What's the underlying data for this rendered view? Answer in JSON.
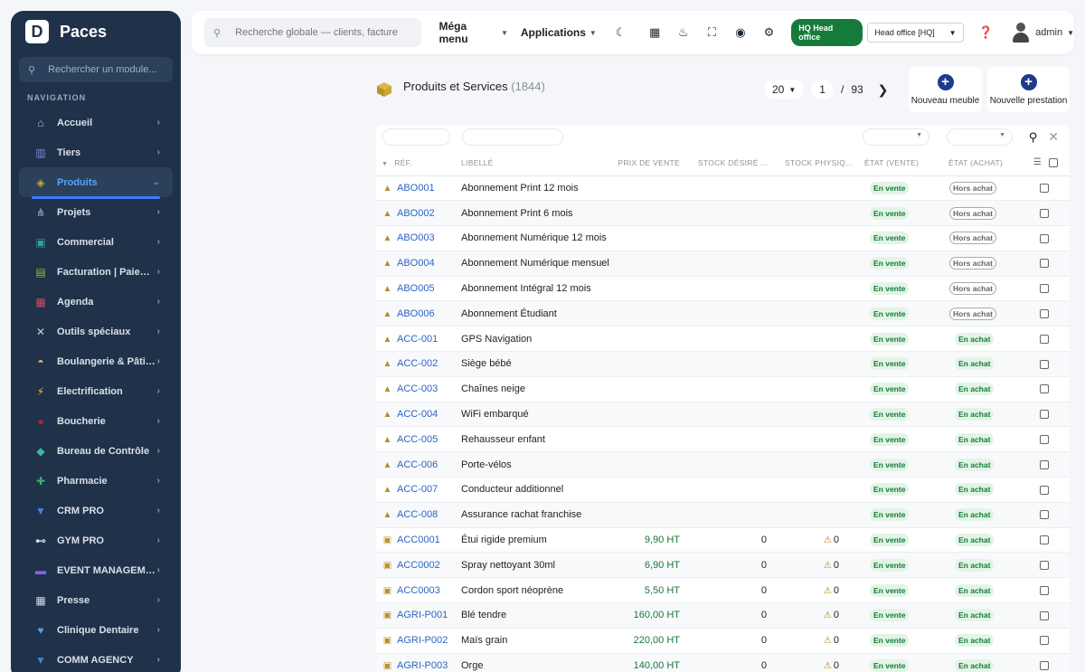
{
  "brand": {
    "logo_letter": "D",
    "name": "Paces"
  },
  "sidebar": {
    "search_placeholder": "Rechercher un module...",
    "section_title": "NAVIGATION",
    "items": [
      {
        "label": "Accueil",
        "icon": "home-icon",
        "glyph": "⌂",
        "color": "#b8c2cf",
        "active": false
      },
      {
        "label": "Tiers",
        "icon": "building-icon",
        "glyph": "▥",
        "color": "#7d86d9",
        "active": false
      },
      {
        "label": "Produits",
        "icon": "box-icon",
        "glyph": "◈",
        "color": "#c9a73a",
        "active": true
      },
      {
        "label": "Projets",
        "icon": "project-icon",
        "glyph": "⋔",
        "color": "#8e9ab0",
        "active": false
      },
      {
        "label": "Commercial",
        "icon": "briefcase-icon",
        "glyph": "▣",
        "color": "#2fa39b",
        "active": false
      },
      {
        "label": "Facturation | Paiement",
        "icon": "invoice-icon",
        "glyph": "▤",
        "color": "#7fbf3f",
        "active": false
      },
      {
        "label": "Agenda",
        "icon": "calendar-icon",
        "glyph": "▦",
        "color": "#c24f6b",
        "active": false
      },
      {
        "label": "Outils spéciaux",
        "icon": "tools-icon",
        "glyph": "✕",
        "color": "#c8cfd9",
        "active": false
      },
      {
        "label": "Boulangerie & Pâtiss...",
        "icon": "bread-icon",
        "glyph": "◓",
        "color": "#e6b86a",
        "active": false
      },
      {
        "label": "Electrification",
        "icon": "bolt-icon",
        "glyph": "⚡",
        "color": "#f2c21a",
        "active": false
      },
      {
        "label": "Boucherie",
        "icon": "meat-icon",
        "glyph": "●",
        "color": "#b0262d",
        "active": false
      },
      {
        "label": "Bureau de Contrôle",
        "icon": "shield-icon",
        "glyph": "◆",
        "color": "#3fb7a5",
        "active": false
      },
      {
        "label": "Pharmacie",
        "icon": "cross-icon",
        "glyph": "✚",
        "color": "#2fb36b",
        "active": false
      },
      {
        "label": "CRM PRO",
        "icon": "funnel-icon",
        "glyph": "▼",
        "color": "#4a7be0",
        "active": false
      },
      {
        "label": "GYM PRO",
        "icon": "dumbbell-icon",
        "glyph": "⊷",
        "color": "#d9dee6",
        "active": false
      },
      {
        "label": "EVENT MANAGEME...",
        "icon": "ticket-icon",
        "glyph": "▬",
        "color": "#8b5cf6",
        "active": false
      },
      {
        "label": "Presse",
        "icon": "newspaper-icon",
        "glyph": "▦",
        "color": "#d7d9e0",
        "active": false
      },
      {
        "label": "Clinique Dentaire",
        "icon": "tooth-icon",
        "glyph": "♥",
        "color": "#4aa3e0",
        "active": false
      },
      {
        "label": "COMM AGENCY",
        "icon": "funnel-icon",
        "glyph": "▼",
        "color": "#4a7be0",
        "active": false
      }
    ]
  },
  "topbar": {
    "search_placeholder": "Recherche globale — clients, factures, p",
    "mega_menu": "Méga menu",
    "applications": "Applications",
    "hq_badge": "HQ Head office",
    "office_select": "Head office [HQ]",
    "user": "admin"
  },
  "page": {
    "title": "Produits et Services",
    "count": "(1844)",
    "per_page": "20",
    "current_page": "1",
    "sep": "/",
    "total_pages": "93",
    "btn_new_furniture": "Nouveau meuble",
    "btn_new_service": "Nouvelle prestation"
  },
  "table": {
    "headers": {
      "ref": "RÉF.",
      "label": "LIBELLÉ",
      "price": "PRIX DE VENTE",
      "stock_desired": "STOCK DÉSIRÉ ...",
      "stock_physical": "STOCK PHYSIQUE",
      "state_sale": "ÉTAT (VENTE)",
      "state_purchase": "ÉTAT (ACHAT)"
    },
    "rows": [
      {
        "type": "service",
        "ref": "ABO001",
        "label": "Abonnement Print 12 mois",
        "price": "",
        "desired": "",
        "physical": "",
        "sale": "En vente",
        "purchase": "Hors achat"
      },
      {
        "type": "service",
        "ref": "ABO002",
        "label": "Abonnement Print 6 mois",
        "price": "",
        "desired": "",
        "physical": "",
        "sale": "En vente",
        "purchase": "Hors achat"
      },
      {
        "type": "service",
        "ref": "ABO003",
        "label": "Abonnement Numérique 12 mois",
        "price": "",
        "desired": "",
        "physical": "",
        "sale": "En vente",
        "purchase": "Hors achat"
      },
      {
        "type": "service",
        "ref": "ABO004",
        "label": "Abonnement Numérique mensuel",
        "price": "",
        "desired": "",
        "physical": "",
        "sale": "En vente",
        "purchase": "Hors achat"
      },
      {
        "type": "service",
        "ref": "ABO005",
        "label": "Abonnement Intégral 12 mois",
        "price": "",
        "desired": "",
        "physical": "",
        "sale": "En vente",
        "purchase": "Hors achat"
      },
      {
        "type": "service",
        "ref": "ABO006",
        "label": "Abonnement Étudiant",
        "price": "",
        "desired": "",
        "physical": "",
        "sale": "En vente",
        "purchase": "Hors achat"
      },
      {
        "type": "service",
        "ref": "ACC-001",
        "label": "GPS Navigation",
        "price": "",
        "desired": "",
        "physical": "",
        "sale": "En vente",
        "purchase": "En achat"
      },
      {
        "type": "service",
        "ref": "ACC-002",
        "label": "Siège bébé",
        "price": "",
        "desired": "",
        "physical": "",
        "sale": "En vente",
        "purchase": "En achat"
      },
      {
        "type": "service",
        "ref": "ACC-003",
        "label": "Chaînes neige",
        "price": "",
        "desired": "",
        "physical": "",
        "sale": "En vente",
        "purchase": "En achat"
      },
      {
        "type": "service",
        "ref": "ACC-004",
        "label": "WiFi embarqué",
        "price": "",
        "desired": "",
        "physical": "",
        "sale": "En vente",
        "purchase": "En achat"
      },
      {
        "type": "service",
        "ref": "ACC-005",
        "label": "Rehausseur enfant",
        "price": "",
        "desired": "",
        "physical": "",
        "sale": "En vente",
        "purchase": "En achat"
      },
      {
        "type": "service",
        "ref": "ACC-006",
        "label": "Porte-vélos",
        "price": "",
        "desired": "",
        "physical": "",
        "sale": "En vente",
        "purchase": "En achat"
      },
      {
        "type": "service",
        "ref": "ACC-007",
        "label": "Conducteur additionnel",
        "price": "",
        "desired": "",
        "physical": "",
        "sale": "En vente",
        "purchase": "En achat"
      },
      {
        "type": "service",
        "ref": "ACC-008",
        "label": "Assurance rachat franchise",
        "price": "",
        "desired": "",
        "physical": "",
        "sale": "En vente",
        "purchase": "En achat"
      },
      {
        "type": "product",
        "ref": "ACC0001",
        "label": "Étui rigide premium",
        "price": "9,90 HT",
        "desired": "0",
        "physical": "0",
        "sale": "En vente",
        "purchase": "En achat"
      },
      {
        "type": "product",
        "ref": "ACC0002",
        "label": "Spray nettoyant 30ml",
        "price": "6,90 HT",
        "desired": "0",
        "physical": "0",
        "sale": "En vente",
        "purchase": "En achat"
      },
      {
        "type": "product",
        "ref": "ACC0003",
        "label": "Cordon sport néoprène",
        "price": "5,50 HT",
        "desired": "0",
        "physical": "0",
        "sale": "En vente",
        "purchase": "En achat"
      },
      {
        "type": "product",
        "ref": "AGRI-P001",
        "label": "Blé tendre",
        "price": "160,00 HT",
        "desired": "0",
        "physical": "0",
        "sale": "En vente",
        "purchase": "En achat"
      },
      {
        "type": "product",
        "ref": "AGRI-P002",
        "label": "Maïs grain",
        "price": "220,00 HT",
        "desired": "0",
        "physical": "0",
        "sale": "En vente",
        "purchase": "En achat"
      },
      {
        "type": "product",
        "ref": "AGRI-P003",
        "label": "Orge",
        "price": "140,00 HT",
        "desired": "0",
        "physical": "0",
        "sale": "En vente",
        "purchase": "En achat"
      }
    ]
  }
}
